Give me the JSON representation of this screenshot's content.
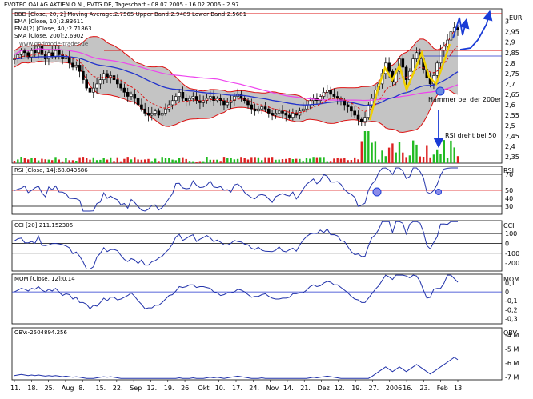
{
  "chart_data": {
    "type": "line",
    "title": "EVOTEC OAI AG AKTIEN O.N., EVTG.DE, Tageschart - 08.07.2005 - 16.02.2006 - 2.97",
    "unit": "EUR",
    "site": "www.godmode-trader.de",
    "x_labels": [
      "11.",
      "18.",
      "25.",
      "Aug",
      "8.",
      "15.",
      "22.",
      "Sep",
      "12.",
      "19.",
      "26.",
      "Okt",
      "10.",
      "17.",
      "24.",
      "Nov",
      "14.",
      "21.",
      "Dez",
      "12.",
      "19.",
      "27.",
      "2006",
      "16.",
      "23.",
      "Feb",
      "13."
    ],
    "price_panel": {
      "legend": [
        {
          "text": "BBD [Close, 20, 2] Moving Average:2.7565 Upper Band:2.9489 Lower Band:2.5681",
          "color": "#cc0000"
        },
        {
          "text": "EMA [Close, 10]:2.83611",
          "color": "#cc0000"
        },
        {
          "text": "EMA(2) [Close, 40]:2.71863",
          "color": "#2222aa"
        },
        {
          "text": "SMA [Close, 200]:2.6902",
          "color": "#ee44ee"
        }
      ],
      "y_ticks": [
        "3",
        "2,95",
        "2,9",
        "2,85",
        "2,8",
        "2,75",
        "2,7",
        "2,65",
        "2,6",
        "2,55",
        "2,5",
        "2,45",
        "2,4",
        "2,35"
      ],
      "ylim": [
        2.32,
        3.06
      ],
      "close": [
        2.82,
        2.84,
        2.86,
        2.85,
        2.83,
        2.86,
        2.85,
        2.88,
        2.84,
        2.82,
        2.85,
        2.83,
        2.86,
        2.84,
        2.82,
        2.83,
        2.8,
        2.78,
        2.79,
        2.76,
        2.72,
        2.68,
        2.66,
        2.68,
        2.7,
        2.72,
        2.75,
        2.73,
        2.74,
        2.72,
        2.7,
        2.68,
        2.66,
        2.64,
        2.65,
        2.63,
        2.6,
        2.58,
        2.56,
        2.55,
        2.56,
        2.57,
        2.55,
        2.56,
        2.58,
        2.6,
        2.62,
        2.64,
        2.66,
        2.63,
        2.62,
        2.63,
        2.64,
        2.62,
        2.61,
        2.62,
        2.63,
        2.64,
        2.62,
        2.63,
        2.62,
        2.6,
        2.61,
        2.62,
        2.64,
        2.65,
        2.63,
        2.62,
        2.6,
        2.58,
        2.57,
        2.58,
        2.59,
        2.58,
        2.56,
        2.55,
        2.56,
        2.57,
        2.56,
        2.55,
        2.54,
        2.56,
        2.55,
        2.57,
        2.58,
        2.6,
        2.62,
        2.63,
        2.62,
        2.64,
        2.66,
        2.67,
        2.65,
        2.64,
        2.63,
        2.62,
        2.6,
        2.59,
        2.57,
        2.55,
        2.53,
        2.52,
        2.54,
        2.6,
        2.63,
        2.67,
        2.7,
        2.75,
        2.8,
        2.76,
        2.71,
        2.76,
        2.82,
        2.78,
        2.72,
        2.76,
        2.82,
        2.85,
        2.82,
        2.77,
        2.73,
        2.7,
        2.74,
        2.8,
        2.86,
        2.88,
        2.91,
        2.95,
        2.97,
        2.96
      ],
      "annotations": [
        "Hammer bei der 200er",
        "RSI dreht bei 50"
      ]
    },
    "rsi_panel": {
      "legend": "RSI [Close, 14]:68.043686",
      "label": "RSI",
      "y_ticks": [
        "70",
        "50",
        "40",
        "30"
      ],
      "ylim": [
        20,
        80
      ]
    },
    "cci_panel": {
      "legend": "CCI [20]:211.152306",
      "label": "CCI",
      "y_ticks": [
        "100",
        "0",
        "-100",
        "-200"
      ],
      "ylim": [
        -280,
        230
      ]
    },
    "mom_panel": {
      "legend": "MOM [Close, 12]:0.14",
      "label": "MOM",
      "y_ticks": [
        "0,1",
        "0",
        "-0,1",
        "-0,2",
        "-0,3"
      ],
      "ylim": [
        -0.36,
        0.2
      ]
    },
    "obv_panel": {
      "legend": "OBV:-2504894.256",
      "label": "OBV",
      "y_ticks": [
        "-4 M",
        "-5 M",
        "-6 M",
        "-7 M"
      ],
      "ylim": [
        -7.2,
        -3.5
      ]
    }
  }
}
